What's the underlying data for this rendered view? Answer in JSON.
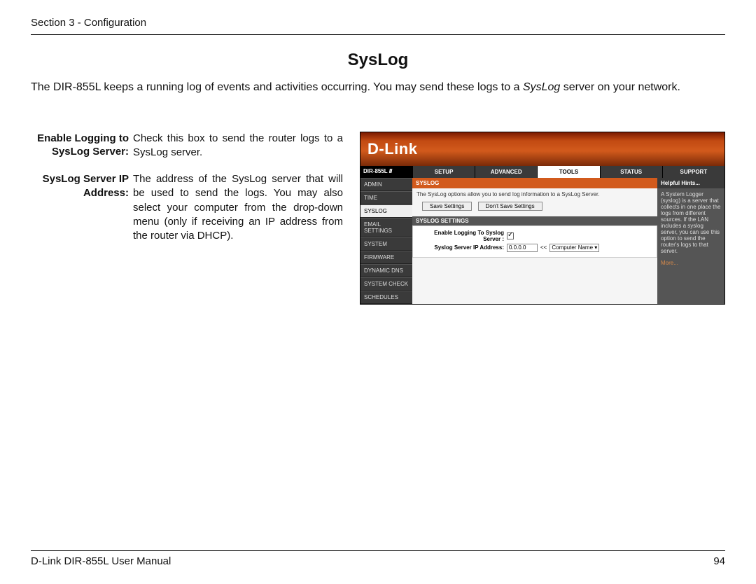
{
  "header": {
    "section": "Section 3 - Configuration"
  },
  "title": "SysLog",
  "intro_pre": "The DIR-855L keeps a running log of events and activities occurring. You may send these logs to a ",
  "intro_em": "SysLog",
  "intro_post": " server on your network.",
  "defs": [
    {
      "term": "Enable Logging to SysLog Server:",
      "desc": "Check this box to send the router logs to a SysLog server."
    },
    {
      "term": "SysLog Server IP Address:",
      "desc": "The address of the SysLog server that will be used to send the logs. You may also select your computer from the drop-down menu (only if receiving an IP address from the router via DHCP)."
    }
  ],
  "screenshot": {
    "logo": "D-Link",
    "model": "DIR-855L",
    "tabs": [
      "SETUP",
      "ADVANCED",
      "TOOLS",
      "STATUS",
      "SUPPORT"
    ],
    "active_tab": "TOOLS",
    "side": [
      "ADMIN",
      "TIME",
      "SYSLOG",
      "EMAIL SETTINGS",
      "SYSTEM",
      "FIRMWARE",
      "DYNAMIC DNS",
      "SYSTEM CHECK",
      "SCHEDULES"
    ],
    "active_side": "SYSLOG",
    "box_title": "SYSLOG",
    "desc": "The SysLog options allow you to send log information to a SysLog Server.",
    "buttons": {
      "save": "Save Settings",
      "dont": "Don't Save Settings"
    },
    "sub_title": "SYSLOG SETTINGS",
    "form": {
      "row1_label": "Enable Logging To Syslog Server :",
      "row2_label": "Syslog Server IP Address:",
      "ip_value": "0.0.0.0",
      "arrows": "<<",
      "computer_name": "Computer Name"
    },
    "hints": {
      "title": "Helpful Hints...",
      "body": "A System Logger (syslog) is a server that collects in one place the logs from different sources. If the LAN includes a syslog server, you can use this option to send the router's logs to that server.",
      "more": "More..."
    }
  },
  "footer": {
    "manual": "D-Link DIR-855L User Manual",
    "page": "94"
  }
}
